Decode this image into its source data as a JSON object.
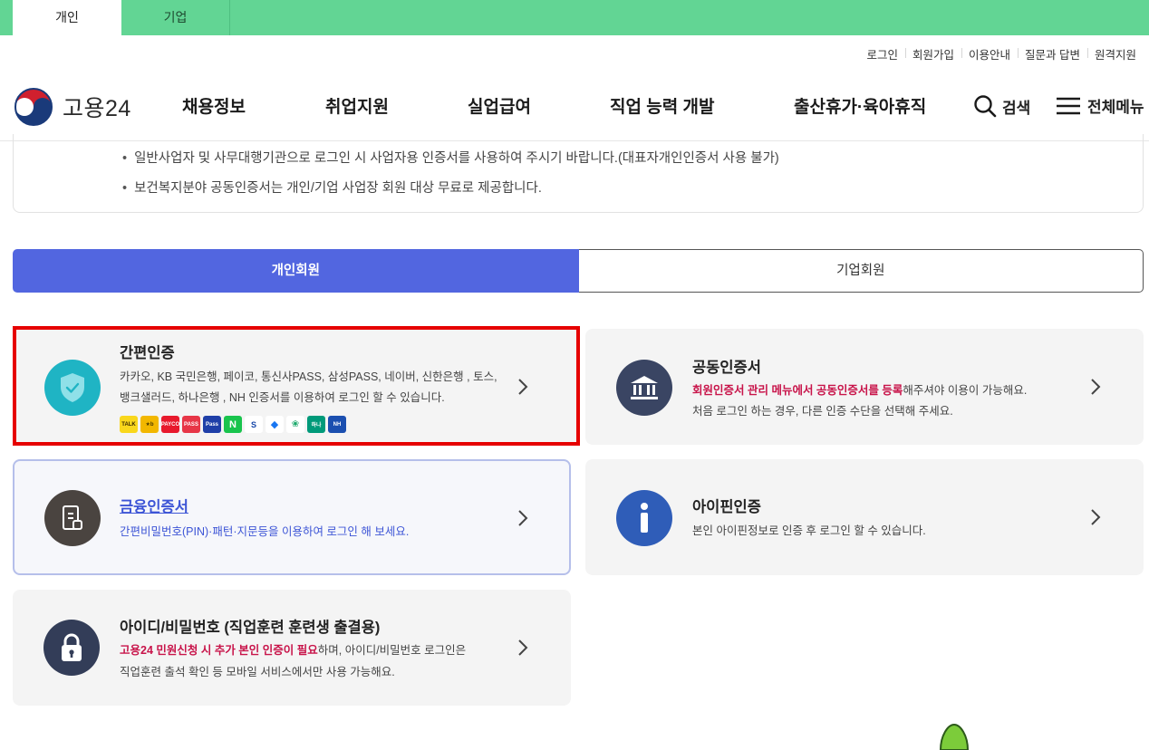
{
  "usertype_tabs": {
    "personal": "개인",
    "business": "기업"
  },
  "util_links": [
    "로그인",
    "회원가입",
    "이용안내",
    "질문과 답변",
    "원격지원"
  ],
  "logo_text": "고용24",
  "gnb": [
    "채용정보",
    "취업지원",
    "실업급여",
    "직업 능력 개발",
    "출산휴가·육아휴직"
  ],
  "search_label": "검색",
  "menu_label": "전체메뉴",
  "notice": [
    "일반사업자 및 사무대행기관으로 로그인 시 사업자용 인증서를 사용하여 주시기 바랍니다.(대표자개인인증서 사용 불가)",
    "보건복지분야 공동인증서는 개인/기업 사업장 회원 대상 무료로 제공합니다."
  ],
  "member_tabs": {
    "personal": "개인회원",
    "business": "기업회원"
  },
  "cards": {
    "simple": {
      "title": "간편인증",
      "desc1": "카카오, KB 국민은행, 페이코, 통신사PASS, 삼성PASS, 네이버, 신한은행 , 토스,",
      "desc2": "뱅크샐러드, 하나은행 , NH 인증서를 이용하여 로그인 할 수 있습니다."
    },
    "cert": {
      "title": "공동인증서",
      "desc1_hl": "회원인증서 관리 메뉴에서 공동인증서를 등록",
      "desc1_rest": "해주셔야 이용이 가능해요.",
      "desc2": "처음 로그인 하는 경우, 다른 인증 수단을 선택해 주세요."
    },
    "finance": {
      "title": "금융인증서",
      "desc": "간편비밀번호(PIN)·패턴·지문등을 이용하여 로그인 해 보세요."
    },
    "ipin": {
      "title": "아이핀인증",
      "desc": "본인 아이핀정보로 인증 후 로그인 할 수 있습니다."
    },
    "idpw": {
      "title": "아이디/비밀번호 (직업훈련 훈련생 출결용)",
      "desc1_hl": "고용24 민원신청 시 추가 본인 인증이 필요",
      "desc1_rest": "하며, 아이디/비밀번호 로그인은",
      "desc2": "직업훈련 출석 확인 등 모바일 서비스에서만 사용 가능해요."
    }
  },
  "colors": {
    "top_bar": "#62d594",
    "primary_tab": "#5266e0",
    "highlight_text": "#c8144a",
    "selection_outline": "#e60000"
  }
}
